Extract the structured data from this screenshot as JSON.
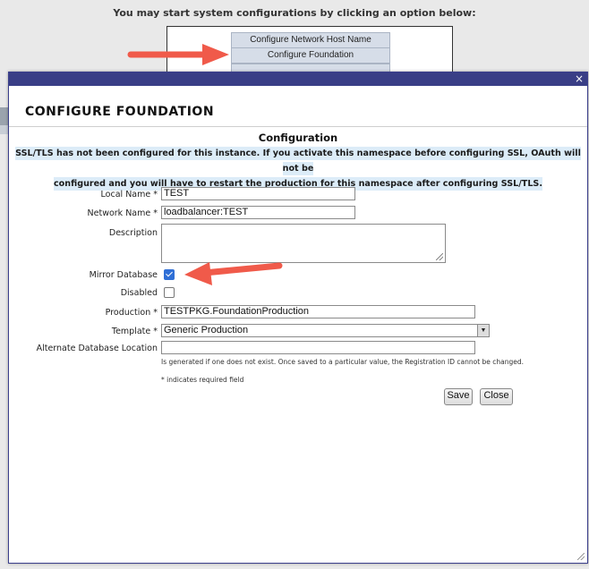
{
  "background": {
    "header": "You may start system configurations by clicking an option below:",
    "options": [
      "Configure Network Host Name",
      "Configure Foundation"
    ]
  },
  "modal": {
    "close": "×",
    "heading": "CONFIGURE FOUNDATION",
    "section_title": "Configuration",
    "warning_line1": "SSL/TLS has not been configured for this instance. If you activate this namespace before configuring SSL, OAuth will not be",
    "warning_line2": "configured and you will have to restart the production for this namespace after configuring SSL/TLS.",
    "fields": {
      "local_name": {
        "label": "Local Name *",
        "value": "TEST"
      },
      "network_name": {
        "label": "Network Name *",
        "value": "loadbalancer:TEST"
      },
      "description": {
        "label": "Description",
        "value": ""
      },
      "mirror_database": {
        "label": "Mirror Database",
        "checked": true
      },
      "disabled": {
        "label": "Disabled",
        "checked": false
      },
      "production": {
        "label": "Production *",
        "value": "TESTPKG.FoundationProduction"
      },
      "template": {
        "label": "Template *",
        "value": "Generic Production"
      },
      "alt_db_location": {
        "label": "Alternate Database Location",
        "value": ""
      }
    },
    "hint": "Is generated if one does not exist. Once saved to a particular value, the Registration ID cannot be changed.",
    "required_note": "* indicates required field",
    "buttons": {
      "save": "Save",
      "close": "Close"
    }
  },
  "colors": {
    "titlebar": "#393e86",
    "warning_bg": "#dcecf8",
    "arrow": "#f05a4a",
    "checkbox": "#2f6fd6"
  }
}
